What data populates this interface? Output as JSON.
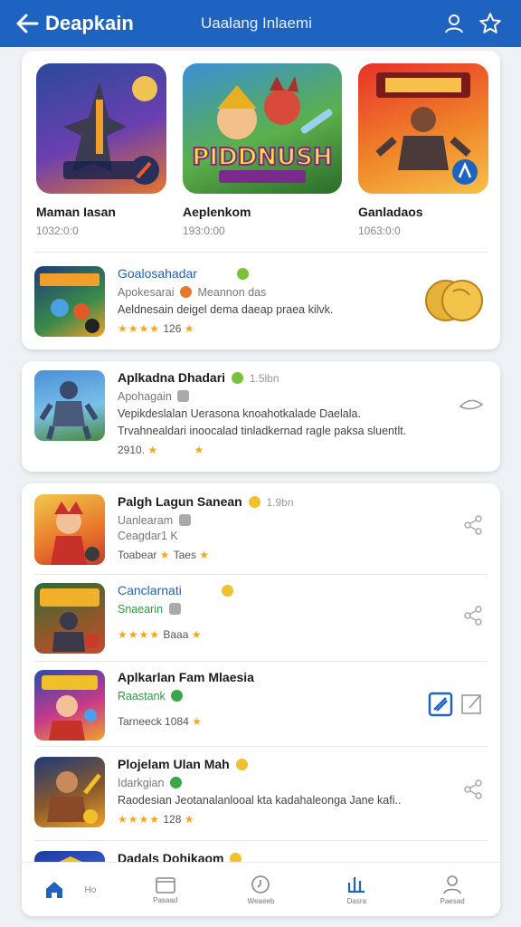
{
  "header": {
    "title": "Deapkain",
    "subtitle": "Uaalang Inlaemi",
    "icons": [
      "back-arrow-icon",
      "user-icon",
      "star-icon"
    ],
    "color": "#1e63bf"
  },
  "featured": [
    {
      "name": "Maman Iasan",
      "count": "1032:0:0"
    },
    {
      "name": "Aeplenkom",
      "count": "193:0:00",
      "art_text": "PIDDNUSH"
    },
    {
      "name": "Ganladaos",
      "count": "1063:0:0"
    }
  ],
  "top_item": {
    "title": "Goalosahadar",
    "sub": "Apokesarai",
    "sub2": "Meannon das",
    "desc": "Aeldnesain deigel dema daeap praea kilvk.",
    "rating_stars": "★★★★",
    "rating_value": "126",
    "icon": "gold-coin-icon"
  },
  "mid_item": {
    "title": "Aplkadna Dhadari",
    "extra": "1.5lbn",
    "sub": "Apohagain",
    "desc1": "Vepikdeslalan Uerasona knoahotkalade Daelala.",
    "desc2": "Trvahnealdari inoocalad tinladkernad ragle paksa sluentlt.",
    "rating": "2910.",
    "icon": "share-icon"
  },
  "list": [
    {
      "title": "Palgh Lagun Sanean",
      "extra": "1.9bn",
      "sub": "Uanlearam",
      "sub2": "Ceagdar1 K",
      "rating_label": "Toabear",
      "rating_value": "Taes",
      "title_style": "normal",
      "sub_style": "normal"
    },
    {
      "title": "Canclarnati",
      "sub": "Snaearin",
      "rating_stars": "★★★★",
      "rating_value": "Baaa",
      "title_style": "blue",
      "sub_style": "green"
    },
    {
      "title": "Aplkarlan Fam Mlaesia",
      "sub": "Raastank",
      "rating_label": "Tarneeck",
      "rating_value": "1084",
      "title_style": "normal",
      "sub_style": "green"
    },
    {
      "title": "Plojelam Ulan Mah",
      "sub": "Idarkgian",
      "desc": "Raodesian Jeotanalanlooal kta kadahaleonga Jane kafi..",
      "rating_stars": "★★★★",
      "rating_value": "128",
      "title_style": "normal",
      "sub_style": "normal"
    },
    {
      "title": "Dadals Dohikaom",
      "title_style": "normal"
    }
  ],
  "nav": [
    {
      "label": "Ho",
      "icon": "home-icon",
      "active": true
    },
    {
      "label": "Pasaad",
      "icon": "folder-icon"
    },
    {
      "label": "Weaeeb",
      "icon": "clock-icon"
    },
    {
      "label": "Dasra",
      "icon": "chart-icon"
    },
    {
      "label": "Paesad",
      "icon": "profile-icon"
    }
  ]
}
